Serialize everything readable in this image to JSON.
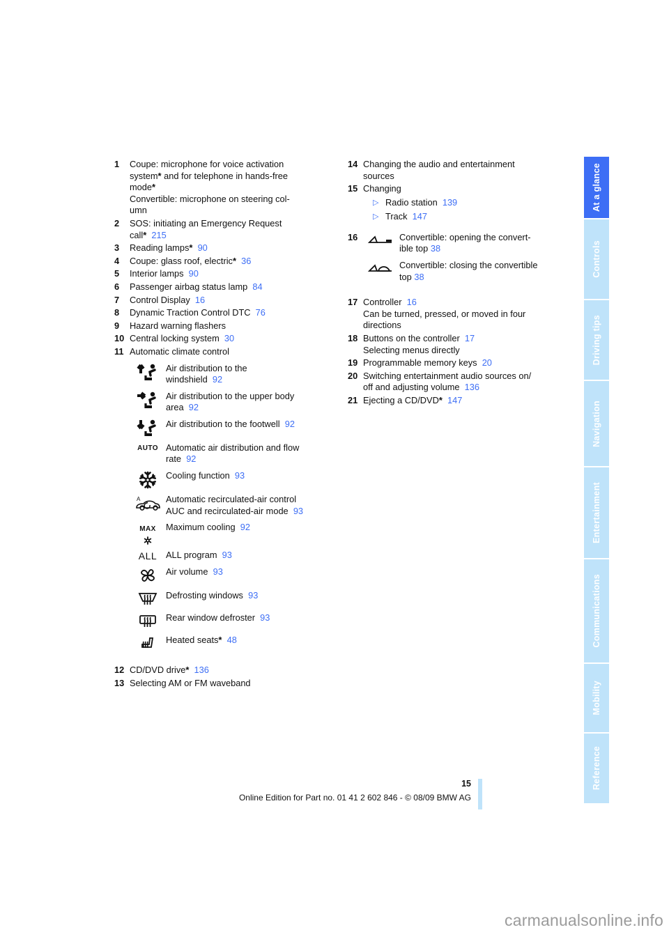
{
  "document": {
    "page_number": "15",
    "footer_note": "Online Edition for Part no. 01 41 2 602 846 - © 08/09 BMW AG",
    "watermark": "carmanualsonline.info",
    "accent_color": "#3d6ef5",
    "tab_inactive_color": "#bfe3fa"
  },
  "tabs": [
    {
      "label": "At a glance",
      "active": true
    },
    {
      "label": "Controls",
      "active": false
    },
    {
      "label": "Driving tips",
      "active": false
    },
    {
      "label": "Navigation",
      "active": false
    },
    {
      "label": "Entertainment",
      "active": false
    },
    {
      "label": "Communications",
      "active": false
    },
    {
      "label": "Mobility",
      "active": false
    },
    {
      "label": "Reference",
      "active": false
    }
  ],
  "left_column": {
    "item1": {
      "num": "1",
      "line1": "Coupe: microphone for voice activation",
      "line2a": "system",
      "line2b": " and for telephone in hands-free",
      "line3": "mode",
      "line4": "Convertible: microphone on steering col-",
      "line5": "umn",
      "star": "*"
    },
    "item2": {
      "num": "2",
      "line1": "SOS: initiating an Emergency Request",
      "line2": "call",
      "star": "*",
      "page": "215"
    },
    "item3": {
      "num": "3",
      "text": "Reading lamps",
      "star": "*",
      "page": "90"
    },
    "item4": {
      "num": "4",
      "text": "Coupe: glass roof, electric",
      "star": "*",
      "page": "36"
    },
    "item5": {
      "num": "5",
      "text": "Interior lamps",
      "page": "90"
    },
    "item6": {
      "num": "6",
      "text": "Passenger airbag status lamp",
      "page": "84"
    },
    "item7": {
      "num": "7",
      "text": "Control Display",
      "page": "16"
    },
    "item8": {
      "num": "8",
      "text": "Dynamic Traction Control DTC",
      "page": "76"
    },
    "item9": {
      "num": "9",
      "text": "Hazard warning flashers"
    },
    "item10": {
      "num": "10",
      "text": "Central locking system",
      "page": "30"
    },
    "item11": {
      "num": "11",
      "text": "Automatic climate control"
    },
    "climate_icons": [
      {
        "icon": "air-distribution-windshield-icon",
        "line1": "Air distribution to the",
        "line2": "windshield",
        "page": "92"
      },
      {
        "icon": "air-distribution-upper-body-icon",
        "line1": "Air distribution to the upper body",
        "line2": "area",
        "page": "92"
      },
      {
        "icon": "air-distribution-footwell-icon",
        "line1": "Air distribution to the footwell",
        "line2": "",
        "page": "92"
      },
      {
        "icon": "auto-climate-icon",
        "label": "AUTO",
        "line1": "Automatic air distribution and flow",
        "line2": "rate",
        "page": "92"
      },
      {
        "icon": "snowflake-cooling-icon",
        "line1": "Cooling function",
        "line2": "",
        "page": "93"
      },
      {
        "icon": "recirculated-air-car-icon",
        "line1": "Automatic recirculated-air control",
        "line2": "AUC and recirculated-air mode",
        "page": "93"
      },
      {
        "icon": "max-cooling-icon",
        "label": "MAX",
        "line1": "Maximum cooling",
        "line2": "",
        "page": "92"
      },
      {
        "icon": "all-program-icon",
        "label": "ALL",
        "line1": "ALL program",
        "line2": "",
        "page": "93"
      },
      {
        "icon": "fan-air-volume-icon",
        "line1": "Air volume",
        "line2": "",
        "page": "93"
      },
      {
        "icon": "defrost-windshield-icon",
        "line1": "Defrosting windows",
        "line2": "",
        "page": "93"
      },
      {
        "icon": "rear-window-defroster-icon",
        "line1": "Rear window defroster",
        "line2": "",
        "page": "93"
      },
      {
        "icon": "heated-seats-icon",
        "line1": "Heated seats",
        "star": "*",
        "line2": "",
        "page": "48"
      }
    ],
    "item12": {
      "num": "12",
      "text": "CD/DVD drive",
      "star": "*",
      "page": "136"
    },
    "item13": {
      "num": "13",
      "text": "Selecting AM or FM waveband"
    }
  },
  "right_column": {
    "item14": {
      "num": "14",
      "line1": "Changing the audio and entertainment",
      "line2": "sources"
    },
    "item15": {
      "num": "15",
      "text": "Changing",
      "bullets": [
        {
          "label": "Radio station",
          "page": "139"
        },
        {
          "label": "Track",
          "page": "147"
        }
      ]
    },
    "item16": {
      "num": "16",
      "rows": [
        {
          "icon": "convertible-top-open-icon",
          "line1": "Convertible: opening the convert-",
          "line2": "ible top",
          "page": "38"
        },
        {
          "icon": "convertible-top-close-icon",
          "line1": "Convertible: closing the convertible",
          "line2": "top",
          "page": "38"
        }
      ]
    },
    "item17": {
      "num": "17",
      "text": "Controller",
      "page": "16",
      "line2": "Can be turned, pressed, or moved in four",
      "line3": "directions"
    },
    "item18": {
      "num": "18",
      "text": "Buttons on the controller",
      "page": "17",
      "line2": "Selecting menus directly"
    },
    "item19": {
      "num": "19",
      "text": "Programmable memory keys",
      "page": "20"
    },
    "item20": {
      "num": "20",
      "line1": "Switching entertainment audio sources on/",
      "line2": "off and adjusting volume",
      "page": "136"
    },
    "item21": {
      "num": "21",
      "text": "Ejecting a CD/DVD",
      "star": "*",
      "page": "147"
    }
  }
}
